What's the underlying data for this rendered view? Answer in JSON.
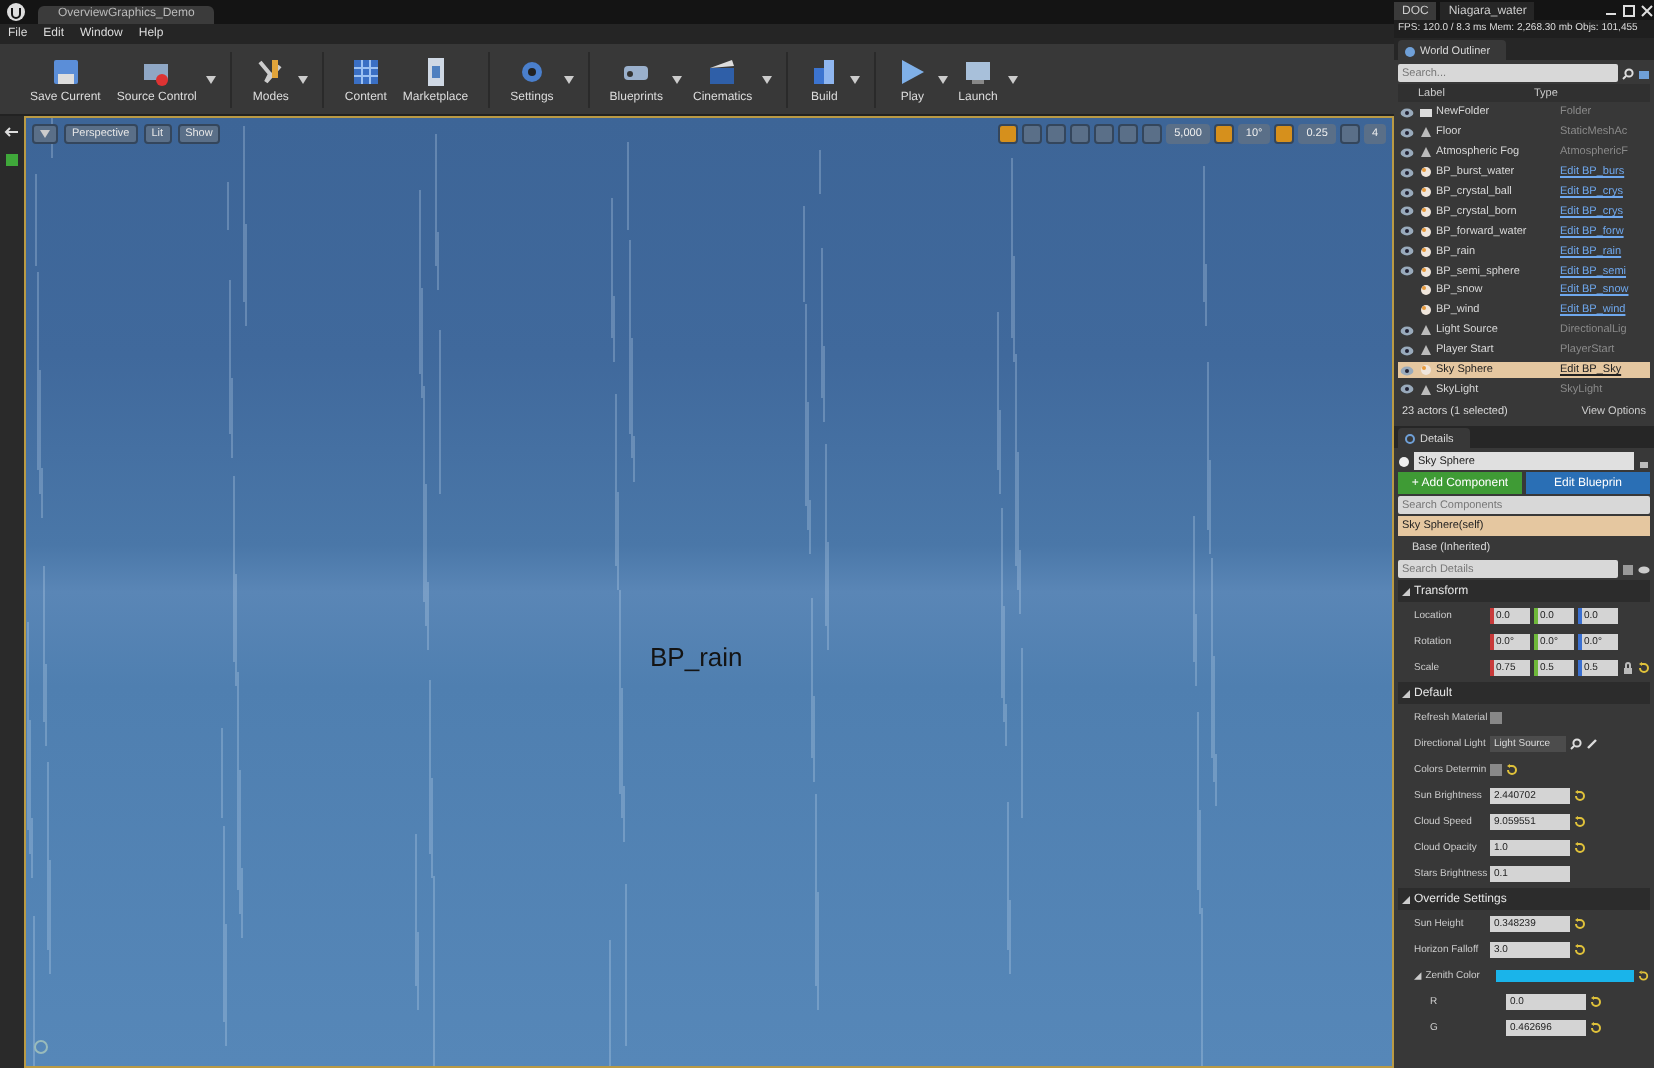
{
  "window": {
    "level_tab": "OverviewGraphics_Demo",
    "side_tabs": [
      {
        "label": "DOC",
        "selected": true
      },
      {
        "label": "Niagara_water",
        "selected": false
      }
    ]
  },
  "stats": "FPS: 120.0 / 8.3 ms  Mem: 2,268.30 mb  Objs: 101,455",
  "menu": [
    "File",
    "Edit",
    "Window",
    "Help"
  ],
  "toolbar": [
    {
      "label": "Save Current",
      "dropdown": false
    },
    {
      "label": "Source Control",
      "dropdown": true
    },
    {
      "label": "Modes",
      "dropdown": true
    },
    {
      "label": "Content",
      "dropdown": false
    },
    {
      "label": "Marketplace",
      "dropdown": false
    },
    {
      "label": "Settings",
      "dropdown": true
    },
    {
      "label": "Blueprints",
      "dropdown": true
    },
    {
      "label": "Cinematics",
      "dropdown": true
    },
    {
      "label": "Build",
      "dropdown": true
    },
    {
      "label": "Play",
      "dropdown": true
    },
    {
      "label": "Launch",
      "dropdown": true
    }
  ],
  "viewport": {
    "buttons": [
      "Perspective",
      "Lit",
      "Show"
    ],
    "snaps": [
      {
        "value": "5,000",
        "active": false
      },
      {
        "value": "10°",
        "active": true
      },
      {
        "value": "0.25",
        "active": true
      },
      {
        "value": "4",
        "active": false
      }
    ],
    "actor_label": "BP_rain"
  },
  "outliner": {
    "title": "World Outliner",
    "search": {
      "placeholder": "Search..."
    },
    "columns": [
      "Label",
      "Type"
    ],
    "rows": [
      {
        "label": "NewFolder",
        "type": "Folder",
        "kind": "folder",
        "visible": true,
        "selected": false
      },
      {
        "label": "Floor",
        "type": "StaticMeshAc",
        "kind": "actor",
        "visible": true,
        "selected": false
      },
      {
        "label": "Atmospheric Fog",
        "type": "AtmosphericF",
        "kind": "actor",
        "visible": true,
        "selected": false
      },
      {
        "label": "BP_burst_water",
        "type": "Edit BP_burs",
        "kind": "blueprint",
        "visible": true,
        "selected": false
      },
      {
        "label": "BP_crystal_ball",
        "type": "Edit BP_crys",
        "kind": "blueprint",
        "visible": true,
        "selected": false
      },
      {
        "label": "BP_crystal_born",
        "type": "Edit BP_crys",
        "kind": "blueprint",
        "visible": true,
        "selected": false
      },
      {
        "label": "BP_forward_water",
        "type": "Edit BP_forw",
        "kind": "blueprint",
        "visible": true,
        "selected": false
      },
      {
        "label": "BP_rain",
        "type": "Edit BP_rain",
        "kind": "blueprint",
        "visible": true,
        "selected": false
      },
      {
        "label": "BP_semi_sphere",
        "type": "Edit BP_semi",
        "kind": "blueprint",
        "visible": true,
        "selected": false
      },
      {
        "label": "BP_snow",
        "type": "Edit BP_snow",
        "kind": "blueprint",
        "visible": false,
        "selected": false
      },
      {
        "label": "BP_wind",
        "type": "Edit BP_wind",
        "kind": "blueprint",
        "visible": false,
        "selected": false
      },
      {
        "label": "Light Source",
        "type": "DirectionalLig",
        "kind": "actor",
        "visible": true,
        "selected": false
      },
      {
        "label": "Player Start",
        "type": "PlayerStart",
        "kind": "actor",
        "visible": true,
        "selected": false
      },
      {
        "label": "Sky Sphere",
        "type": "Edit BP_Sky",
        "kind": "blueprint",
        "visible": true,
        "selected": true
      },
      {
        "label": "SkyLight",
        "type": "SkyLight",
        "kind": "actor",
        "visible": true,
        "selected": false
      }
    ],
    "footer": "23 actors (1 selected)",
    "view_options": "View Options"
  },
  "details": {
    "title": "Details",
    "name": "Sky Sphere",
    "add_component": "+ Add Component",
    "edit_blueprint": "Edit Blueprin",
    "search_components": {
      "placeholder": "Search Components"
    },
    "components": [
      {
        "label": "Sky Sphere(self)",
        "selected": true
      },
      {
        "label": "Base (Inherited)",
        "selected": false
      }
    ],
    "search_details": {
      "placeholder": "Search Details"
    },
    "sections": [
      {
        "title": "Transform",
        "expanded": true,
        "fields": [
          {
            "kind": "vector",
            "label": "Location",
            "values": [
              "0.0",
              "0.0",
              "0.0"
            ],
            "lock": false
          },
          {
            "kind": "vector",
            "label": "Rotation",
            "values": [
              "0.0°",
              "0.0°",
              "0.0°"
            ],
            "lock": false
          },
          {
            "kind": "vector",
            "label": "Scale",
            "values": [
              "0.75",
              "0.5",
              "0.5"
            ],
            "lock": true
          }
        ]
      },
      {
        "title": "Default",
        "expanded": true,
        "fields": [
          {
            "kind": "checkbox",
            "label": "Refresh Material",
            "checked": false,
            "reset": false
          },
          {
            "kind": "dropdown",
            "label": "Directional Light",
            "value": "Light Source"
          },
          {
            "kind": "checkbox",
            "label": "Colors Determin",
            "checked": false,
            "reset": true
          },
          {
            "kind": "number",
            "label": "Sun Brightness",
            "value": "2.440702",
            "reset": true
          },
          {
            "kind": "number",
            "label": "Cloud Speed",
            "value": "9.059551",
            "reset": true
          },
          {
            "kind": "number",
            "label": "Cloud Opacity",
            "value": "1.0",
            "reset": true
          },
          {
            "kind": "number",
            "label": "Stars Brightness",
            "value": "0.1",
            "reset": false
          }
        ]
      },
      {
        "title": "Override Settings",
        "expanded": true,
        "fields": [
          {
            "kind": "number",
            "label": "Sun Height",
            "value": "0.348239",
            "reset": true
          },
          {
            "kind": "number",
            "label": "Horizon Falloff",
            "value": "3.0",
            "reset": true
          },
          {
            "kind": "color",
            "label": "Zenith Color",
            "color": "#1ab4ea",
            "reset": true,
            "expanded": true,
            "children": [
              {
                "kind": "number",
                "label": "R",
                "value": "0.0",
                "reset": true
              },
              {
                "kind": "number",
                "label": "G",
                "value": "0.462696",
                "reset": true
              }
            ]
          }
        ]
      }
    ]
  }
}
